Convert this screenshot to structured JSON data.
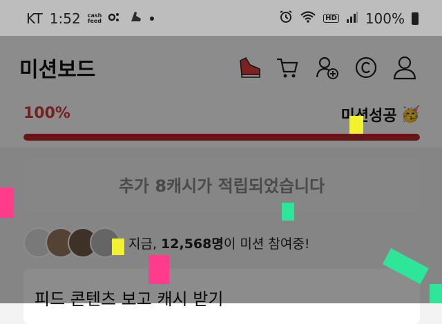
{
  "status_bar": {
    "carrier": "KT",
    "time": "1:52",
    "cashfeed_top": "cash",
    "cashfeed_bottom": "feed",
    "battery": "100%",
    "hd": "HD"
  },
  "header": {
    "title": "미션보드"
  },
  "progress": {
    "percent_label": "100%",
    "value": 1.0,
    "status_label": "미션성공",
    "status_emoji": "🥳"
  },
  "reward": {
    "label": "추가 8캐시가 적립되었습니다"
  },
  "participants": {
    "prefix": "지금,",
    "count": "12,568명",
    "suffix": "이 미션 참여중!"
  },
  "feed_card": {
    "title": "피드 콘텐츠 보고 캐시 받기"
  },
  "colors": {
    "accent_red": "#c0262a",
    "confetti_yellow": "#f2f230",
    "confetti_pink": "#ff3c8c",
    "confetti_green": "#2ee59a"
  }
}
